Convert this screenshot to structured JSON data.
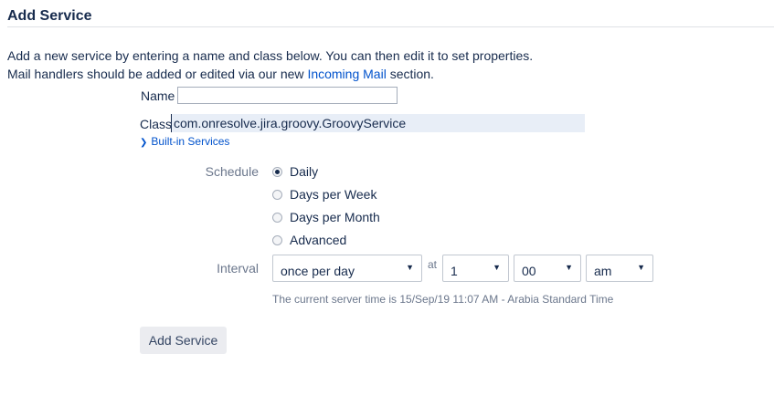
{
  "page": {
    "title": "Add Service",
    "description_line1": "Add a new service by entering a name and class below. You can then edit it to set properties.",
    "description_line2_prefix": "Mail handlers should be added or edited via our new ",
    "description_line2_link": "Incoming Mail",
    "description_line2_suffix": " section."
  },
  "form": {
    "name_label": "Name",
    "name_value": "",
    "class_label": "Class",
    "class_value": "com.onresolve.jira.groovy.GroovyService",
    "builtin_link": "Built-in Services",
    "schedule_label": "Schedule",
    "schedule_options": [
      "Daily",
      "Days per Week",
      "Days per Month",
      "Advanced"
    ],
    "schedule_selected": "Daily",
    "interval_label": "Interval",
    "interval_value": "once per day",
    "at_label": "at",
    "hour_value": "1",
    "minute_value": "00",
    "ampm_value": "am",
    "server_time_hint": "The current server time is 15/Sep/19 11:07 AM - Arabia Standard Time",
    "submit_label": "Add Service"
  },
  "icons": {
    "chevron": "chevron-right-icon",
    "dropdown": "chevron-down-icon"
  },
  "colors": {
    "link": "#0052cc",
    "text": "#172b4d",
    "muted": "#6b778c",
    "button_bg": "#ebecf0"
  }
}
